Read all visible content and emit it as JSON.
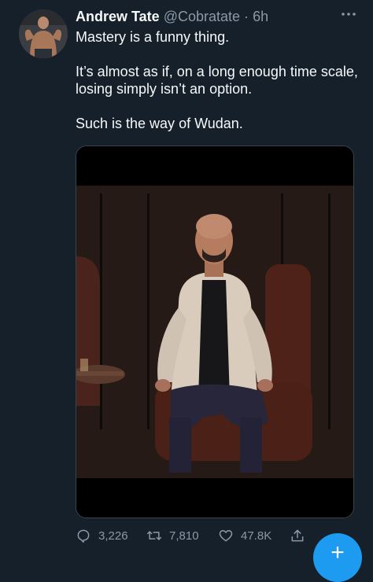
{
  "tweet": {
    "author_name": "Andrew Tate",
    "handle": "@Cobratate",
    "separator": "·",
    "time": "6h",
    "more_icon": "more-horizontal-icon",
    "paragraphs": [
      "Mastery is a funny thing.",
      "It’s almost as if, on a long enough time scale, losing simply isn’t an option.",
      "Such is the way of Wudan."
    ]
  },
  "actions": {
    "reply": {
      "icon": "reply-icon",
      "count": "3,226"
    },
    "retweet": {
      "icon": "retweet-icon",
      "count": "7,810"
    },
    "like": {
      "icon": "heart-icon",
      "count": "47.8K"
    },
    "share": {
      "icon": "share-icon"
    }
  },
  "compose_button": {
    "icon": "compose-plus-icon",
    "label": "+"
  },
  "colors": {
    "background": "#15202b",
    "text_primary": "#f7f9f9",
    "text_secondary": "#8b98a5",
    "accent": "#1d9bf0"
  }
}
